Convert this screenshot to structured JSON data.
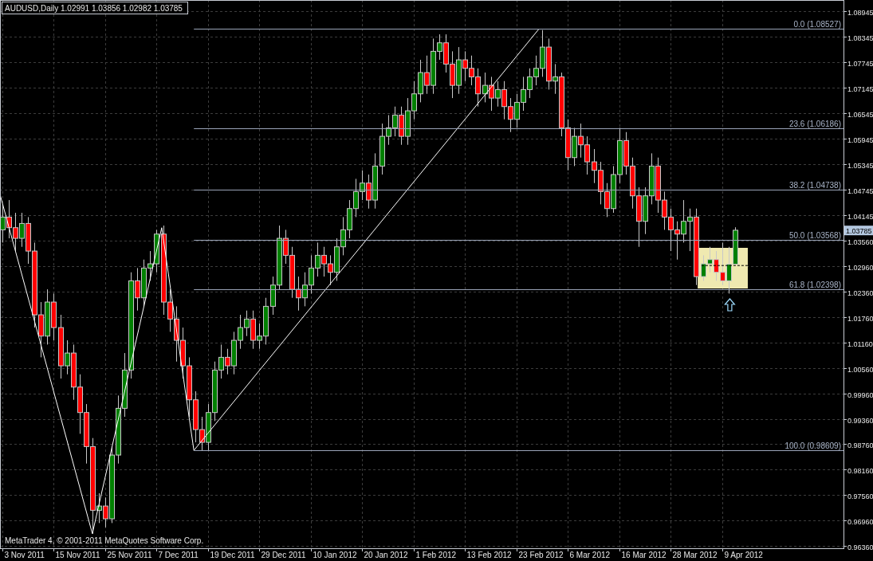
{
  "title": "AUDUSD,Daily 1.02991 1.03856 1.02982 1.03785",
  "price_axis": [
    "1.08945",
    "1.08345",
    "1.07745",
    "1.07145",
    "1.06545",
    "1.05945",
    "1.05345",
    "1.04745",
    "1.04145",
    "1.03560",
    "1.02960",
    "1.02360",
    "1.01760",
    "1.01160",
    "1.00560",
    "0.99960",
    "0.99360",
    "0.98760",
    "0.98160",
    "0.97560",
    "0.96960",
    "0.96360"
  ],
  "date_axis": [
    "3 Nov 2011",
    "15 Nov 2011",
    "25 Nov 2011",
    "7 Dec 2011",
    "19 Dec 2011",
    "29 Dec 2011",
    "10 Jan 2012",
    "20 Jan 2012",
    "1 Feb 2012",
    "13 Feb 2012",
    "23 Feb 2012",
    "6 Mar 2012",
    "16 Mar 2012",
    "28 Mar 2012",
    "9 Apr 2012"
  ],
  "fibonacci_levels": [
    "0.0 (1.08527)",
    "23.6 (1.06186)",
    "38.2 (1.04738)",
    "50.0 (1.03568)",
    "61.8 (1.02398)",
    "100.0 (0.98609)"
  ],
  "current_price": "1.03785",
  "copyright": "MetaTrader 4, © 2001-2011 MetaQuotes Software Corp."
}
